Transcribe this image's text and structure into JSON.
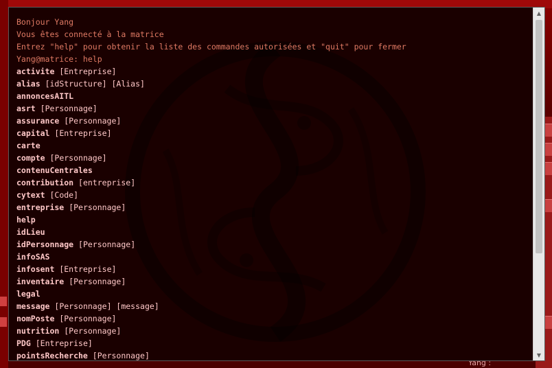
{
  "terminal": {
    "greeting": "Bonjour Yang",
    "connected": "Vous êtes connecté à la matrice",
    "instructions": "Entrez \"help\" pour obtenir la liste des commandes autorisées et \"quit\" pour fermer",
    "prompt": "Yang@matrice: help",
    "commands": [
      {
        "name": "activite",
        "args": "[Entreprise]"
      },
      {
        "name": "alias",
        "args": "[idStructure] [Alias]"
      },
      {
        "name": "annoncesAITL",
        "args": ""
      },
      {
        "name": "asrt",
        "args": "[Personnage]"
      },
      {
        "name": "assurance",
        "args": "[Personnage]"
      },
      {
        "name": "capital",
        "args": "[Entreprise]"
      },
      {
        "name": "carte",
        "args": ""
      },
      {
        "name": "compte",
        "args": "[Personnage]"
      },
      {
        "name": "contenuCentrales",
        "args": ""
      },
      {
        "name": "contribution",
        "args": "[entreprise]"
      },
      {
        "name": "cytext",
        "args": "[Code]"
      },
      {
        "name": "entreprise",
        "args": "[Personnage]"
      },
      {
        "name": "help",
        "args": ""
      },
      {
        "name": "idLieu",
        "args": ""
      },
      {
        "name": "idPersonnage",
        "args": "[Personnage]"
      },
      {
        "name": "infoSAS",
        "args": ""
      },
      {
        "name": "infosent",
        "args": "[Entreprise]"
      },
      {
        "name": "inventaire",
        "args": "[Personnage]"
      },
      {
        "name": "legal",
        "args": ""
      },
      {
        "name": "message",
        "args": "[Personnage] [message]"
      },
      {
        "name": "nomPoste",
        "args": "[Personnage]"
      },
      {
        "name": "nutrition",
        "args": "[Personnage]"
      },
      {
        "name": "PDG",
        "args": "[Entreprise]"
      },
      {
        "name": "pointsRecherche",
        "args": "[Personnage]"
      }
    ]
  },
  "background": {
    "partial_text": "Yang :"
  },
  "colors": {
    "terminal_bg": "#1a0000",
    "system_text": "#e07a64",
    "command_text": "#ffc8c8",
    "desktop_bg": "#6b0000"
  },
  "icons": {
    "emblem": "dragon-yin-yang-icon",
    "scroll_up": "triangle-up-icon",
    "scroll_down": "triangle-down-icon"
  }
}
